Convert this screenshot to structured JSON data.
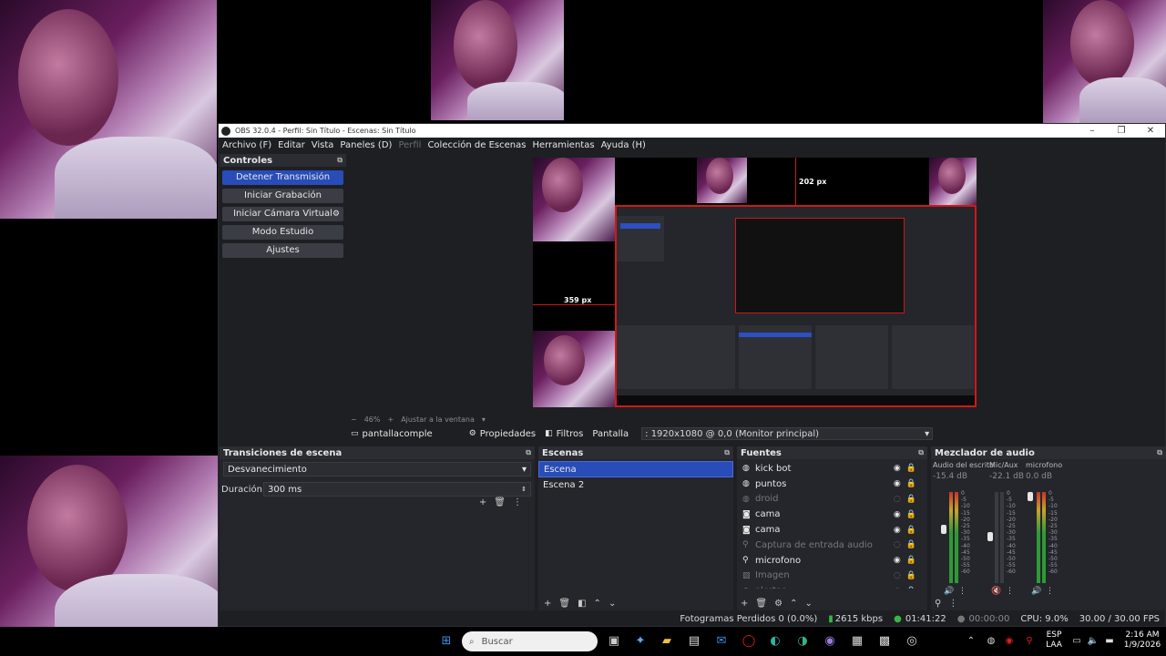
{
  "window": {
    "title": "OBS 32.0.4 - Perfil: Sin Título - Escenas: Sin Título"
  },
  "menu": [
    {
      "label": "Archivo (F)",
      "dim": false
    },
    {
      "label": "Editar",
      "dim": false
    },
    {
      "label": "Vista",
      "dim": false
    },
    {
      "label": "Paneles (D)",
      "dim": false
    },
    {
      "label": "Perfil",
      "dim": true
    },
    {
      "label": "Colección de Escenas",
      "dim": false
    },
    {
      "label": "Herramientas",
      "dim": false
    },
    {
      "label": "Ayuda (H)",
      "dim": false
    }
  ],
  "controls": {
    "title": "Controles",
    "stop_stream": "Detener Transmisión",
    "start_recording": "Iniciar Grabación",
    "start_virtualcam": "Iniciar Cámara Virtual",
    "studio_mode": "Modo Estudio",
    "settings": "Ajustes"
  },
  "preview": {
    "label_top": "202 px",
    "label_left": "359 px",
    "zoom": "46%",
    "fit": "Ajustar a la ventana"
  },
  "source_toolbar": {
    "selected_source": "pantallacomple",
    "properties": "Propiedades",
    "filters": "Filtros",
    "display_label": "Pantalla",
    "display_value": ": 1920x1080 @ 0,0 (Monitor principal)"
  },
  "transitions": {
    "title": "Transiciones de escena",
    "transition": "Desvanecimiento",
    "duration_label": "Duración",
    "duration_value": "300 ms"
  },
  "scenes": {
    "title": "Escenas",
    "items": [
      {
        "label": "Escena",
        "selected": true
      },
      {
        "label": "Escena 2",
        "selected": false
      }
    ]
  },
  "sources": {
    "title": "Fuentes",
    "items": [
      {
        "label": "kick bot",
        "icon": "globe-icon",
        "visible": true
      },
      {
        "label": "puntos",
        "icon": "globe-icon",
        "visible": true
      },
      {
        "label": "droid",
        "icon": "globe-icon",
        "visible": false
      },
      {
        "label": "cama",
        "icon": "camera-icon",
        "visible": true
      },
      {
        "label": "cama",
        "icon": "camera-icon",
        "visible": true
      },
      {
        "label": "Captura de entrada audio",
        "icon": "mic-icon",
        "visible": false
      },
      {
        "label": "microfono",
        "icon": "mic-icon",
        "visible": true
      },
      {
        "label": "Imagen",
        "icon": "image-icon",
        "visible": false
      },
      {
        "label": "alertas",
        "icon": "globe-icon",
        "visible": false
      }
    ]
  },
  "mixer": {
    "title": "Mezclador de audio",
    "channels": [
      {
        "name": "Audio del escrito",
        "db": "-15.4 dB"
      },
      {
        "name": "Mic/Aux",
        "db": "-22.1 dB"
      },
      {
        "name": "microfono",
        "db": "0.0 dB"
      }
    ],
    "scale": [
      "0",
      "-5",
      "-10",
      "-15",
      "-20",
      "-25",
      "-30",
      "-35",
      "-40",
      "-45",
      "-50",
      "-55",
      "-60"
    ]
  },
  "status": {
    "dropped": "Fotogramas Perdidos 0 (0.0%)",
    "bitrate": "2615 kbps",
    "stream_time": "01:41:22",
    "rec_time": "00:00:00",
    "cpu": "CPU: 9.0%",
    "fps": "30.00 / 30.00 FPS"
  },
  "taskbar": {
    "search_placeholder": "Buscar",
    "lang_top": "ESP",
    "lang_bottom": "LAA",
    "time": "2:16 AM",
    "date": "1/9/2026"
  },
  "colors": {
    "accent_blue": "#284cb8",
    "obs_bg": "#1e1f22",
    "bounding_red": "#d01818",
    "meter_green": "#2e9a36"
  }
}
